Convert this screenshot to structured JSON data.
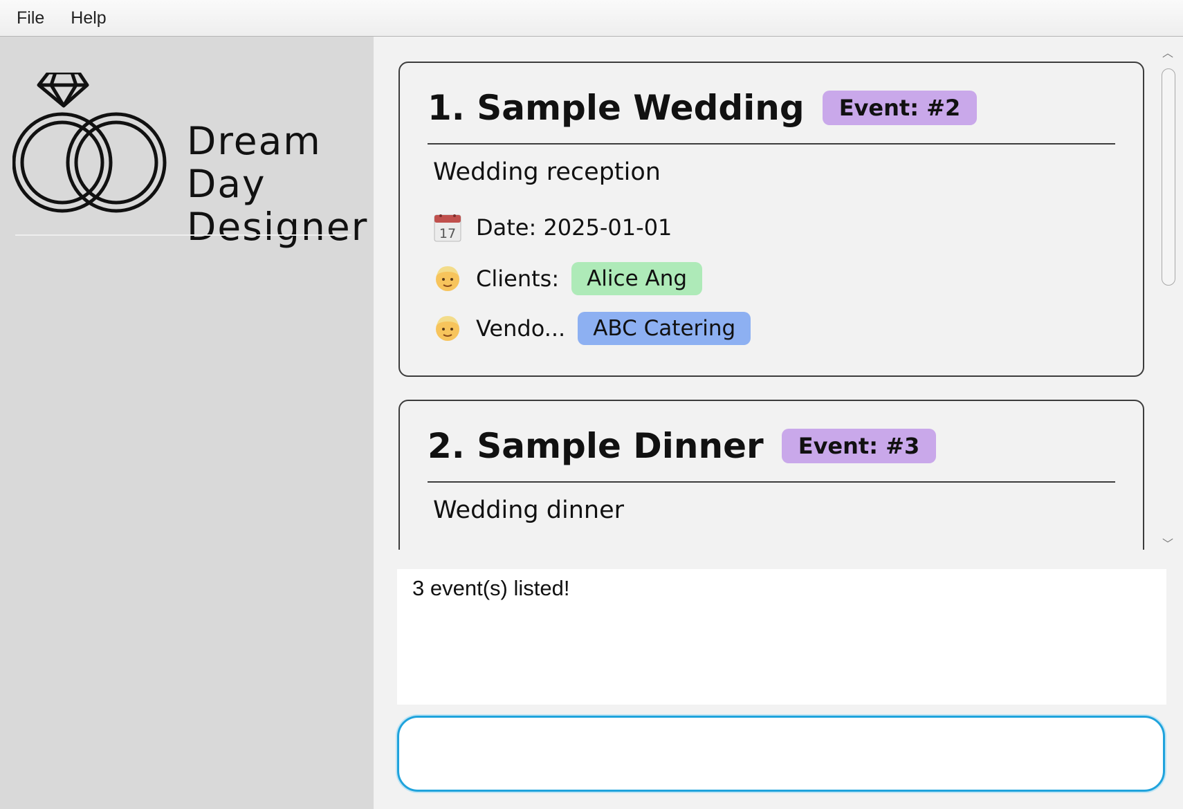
{
  "menu": {
    "file": "File",
    "help": "Help"
  },
  "logo": {
    "line1": "Dream",
    "line2": "Day",
    "line3": "Designer"
  },
  "events": [
    {
      "title": "1. Sample Wedding",
      "badge": "Event: #2",
      "description": "Wedding reception",
      "date": "Date: 2025-01-01",
      "clients_label": "Clients:",
      "clients": [
        "Alice Ang"
      ],
      "vendors_label": "Vendo...",
      "vendors": [
        "ABC Catering"
      ]
    },
    {
      "title": "2. Sample Dinner",
      "badge": "Event: #3",
      "description": "Wedding dinner"
    }
  ],
  "icons": {
    "date": "calendar-icon",
    "clients": "person-icon",
    "vendors": "person-icon"
  },
  "colors": {
    "event_badge": "#c9a8ea",
    "client_chip": "#aeeab8",
    "vendor_chip": "#8db0f2",
    "input_border": "#1fa3dc"
  },
  "result": {
    "message": "3 event(s) listed!"
  },
  "command": {
    "value": "",
    "placeholder": ""
  }
}
